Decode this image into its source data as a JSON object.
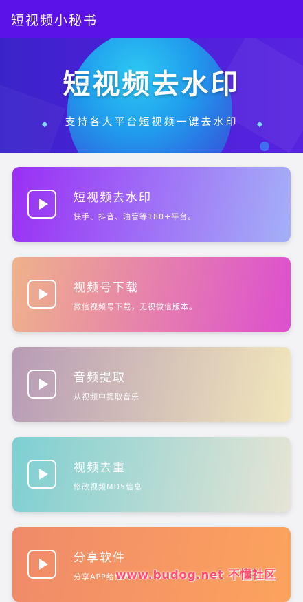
{
  "appbar": {
    "title": "短视频小秘书"
  },
  "banner": {
    "title": "短视频去水印",
    "subtitle": "支持各大平台短视频一键去水印"
  },
  "cards": [
    {
      "title": "短视频去水印",
      "desc": "快手、抖音、油管等180+平台。",
      "icon": "play-icon",
      "gradient": [
        "#9a2ff5",
        "#a4b0f7"
      ]
    },
    {
      "title": "视频号下载",
      "desc": "微信视频号下载，无视微信版本。",
      "icon": "play-icon",
      "gradient": [
        "#efb28a",
        "#dc4fcf"
      ]
    },
    {
      "title": "音频提取",
      "desc": "从视频中提取音乐",
      "icon": "play-icon",
      "gradient": [
        "#b79bb6",
        "#f1e6ba"
      ]
    },
    {
      "title": "视频去重",
      "desc": "修改视频MD5信息",
      "icon": "play-icon",
      "gradient": [
        "#7dcfd2",
        "#e6e4d4"
      ]
    },
    {
      "title": "分享软件",
      "desc": "分享APP给他人",
      "icon": "play-icon",
      "gradient": [
        "#f08a6a",
        "#fca35d"
      ]
    }
  ],
  "watermark": {
    "text": "www.budog.net 不懂社区"
  },
  "colors": {
    "appbar": "#5a12e6",
    "background": "#f3f3f5"
  }
}
